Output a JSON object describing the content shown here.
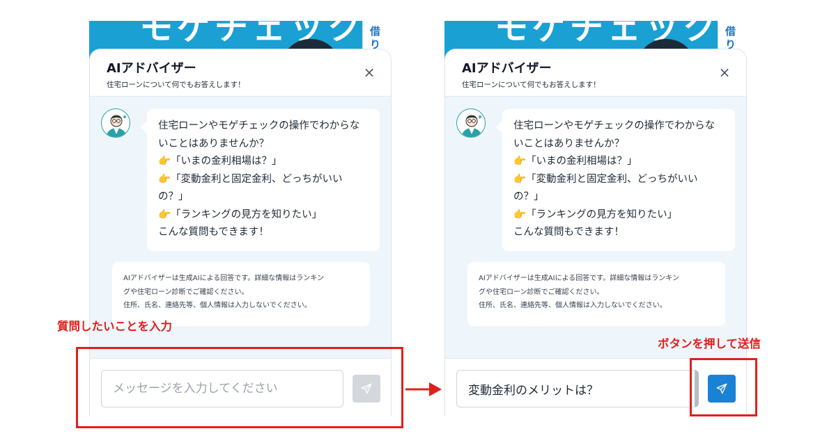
{
  "banner": {
    "side_text": "借り"
  },
  "chat": {
    "title": "AIアドバイザー",
    "subtitle": "住宅ローンについて何でもお答えします！",
    "close_icon": "×",
    "greeting_lines": [
      "住宅ローンやモゲチェックの操作でわからな",
      "いことはありませんか？",
      "👉「いまの金利相場は？」",
      "👉「変動金利と固定金利、どっちがいい",
      "の？」",
      "👉「ランキングの見方を知りたい」",
      "こんな質問もできます！"
    ],
    "notice_lines": [
      "AIアドバイザーは生成AIによる回答です。詳細な情報はランキン",
      "グや住宅ローン診断でご確認ください。",
      "住所、氏名、連絡先等、個人情報は入力しないでください。"
    ]
  },
  "left_panel": {
    "input_placeholder": "メッセージを入力してください",
    "input_value": "",
    "send_state": "disabled"
  },
  "right_panel": {
    "input_placeholder": "メッセージを入力してください",
    "input_value": "変動金利のメリットは？",
    "send_state": "active"
  },
  "annotations": {
    "step1_label": "質問したいことを入力",
    "step2_label": "ボタンを押して送信"
  },
  "colors": {
    "annotation_red": "#e0201c",
    "send_active": "#1a82d4",
    "send_disabled": "#d4d8dd",
    "chat_bg": "#eef6fc",
    "banner_blue": "#1aa0d3"
  },
  "icons": [
    "close-icon",
    "send-icon",
    "advisor-avatar-icon",
    "arrow-right-icon"
  ]
}
